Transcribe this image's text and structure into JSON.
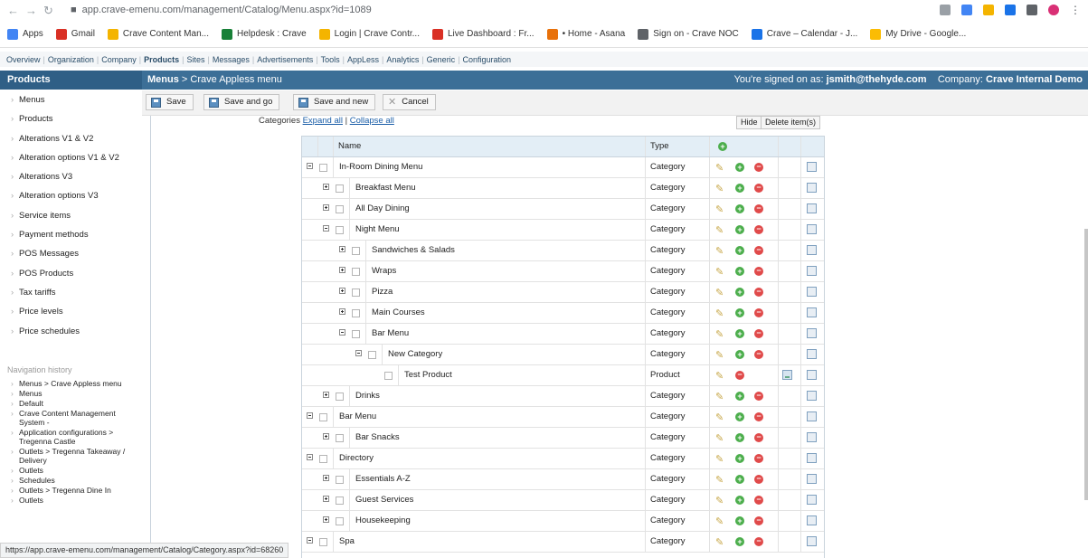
{
  "browser": {
    "url": "app.crave-emenu.com/management/Catalog/Menu.aspx?id=1089",
    "bookmarks": [
      {
        "label": "Apps",
        "color": "#4285f4"
      },
      {
        "label": "Gmail",
        "color": "#d93025"
      },
      {
        "label": "Crave Content Man...",
        "color": "#f4b400"
      },
      {
        "label": "Helpdesk : Crave",
        "color": "#188038"
      },
      {
        "label": "Login | Crave Contr...",
        "color": "#f4b400"
      },
      {
        "label": "Live Dashboard : Fr...",
        "color": "#d93025"
      },
      {
        "label": "• Home - Asana",
        "color": "#e8710a"
      },
      {
        "label": "Sign on - Crave NOC",
        "color": "#5f6368"
      },
      {
        "label": "Crave – Calendar - J...",
        "color": "#1a73e8"
      },
      {
        "label": "My Drive - Google...",
        "color": "#fbbc04"
      }
    ],
    "status_url": "https://app.crave-emenu.com/management/Catalog/Category.aspx?id=68260"
  },
  "app_menu": [
    {
      "label": "Overview",
      "active": false
    },
    {
      "label": "Organization",
      "active": false
    },
    {
      "label": "Company",
      "active": false
    },
    {
      "label": "Products",
      "active": true
    },
    {
      "label": "Sites",
      "active": false
    },
    {
      "label": "Messages",
      "active": false
    },
    {
      "label": "Advertisements",
      "active": false
    },
    {
      "label": "Tools",
      "active": false
    },
    {
      "label": "AppLess",
      "active": false
    },
    {
      "label": "Analytics",
      "active": false
    },
    {
      "label": "Generic",
      "active": false
    },
    {
      "label": "Configuration",
      "active": false
    }
  ],
  "sidebar": {
    "title": "Products",
    "items": [
      "Menus",
      "Products",
      "Alterations V1 & V2",
      "Alteration options V1 & V2",
      "Alterations V3",
      "Alteration options V3",
      "Service items",
      "Payment methods",
      "POS Messages",
      "POS Products",
      "Tax tariffs",
      "Price levels",
      "Price schedules"
    ],
    "history_title": "Navigation history",
    "history": [
      "Menus > Crave Appless menu",
      "Menus",
      "Default",
      "Crave Content Management System -",
      "Application configurations > Tregenna Castle",
      "Outlets > Tregenna Takeaway / Delivery",
      "Outlets",
      "Schedules",
      "Outlets > Tregenna Dine In",
      "Outlets"
    ]
  },
  "header": {
    "breadcrumb_section": "Menus",
    "breadcrumb_sep": ">",
    "breadcrumb_page": "Crave Appless menu",
    "signed_label": "You're signed on as:",
    "signed_user": "jsmith@thehyde.com",
    "company_label": "Company:",
    "company_name": "Crave Internal Demo"
  },
  "toolbar": {
    "save": "Save",
    "save_go": "Save and go",
    "save_new": "Save and new",
    "cancel": "Cancel"
  },
  "categories": {
    "label": "Categories",
    "expand_all": "Expand all",
    "separator": "|",
    "collapse_all": "Collapse all",
    "hide": "Hide",
    "delete_items": "Delete item(s)"
  },
  "grid": {
    "col_name": "Name",
    "col_type": "Type",
    "rows": [
      {
        "name": "In-Room Dining Menu",
        "type": "Category",
        "depth": 0,
        "expanded": true,
        "add": true
      },
      {
        "name": "Breakfast Menu",
        "type": "Category",
        "depth": 1,
        "expanded": false,
        "add": true
      },
      {
        "name": "All Day Dining",
        "type": "Category",
        "depth": 1,
        "expanded": false,
        "add": true
      },
      {
        "name": "Night Menu",
        "type": "Category",
        "depth": 1,
        "expanded": true,
        "add": true
      },
      {
        "name": "Sandwiches & Salads",
        "type": "Category",
        "depth": 2,
        "expanded": false,
        "add": true
      },
      {
        "name": "Wraps",
        "type": "Category",
        "depth": 2,
        "expanded": false,
        "add": true
      },
      {
        "name": "Pizza",
        "type": "Category",
        "depth": 2,
        "expanded": false,
        "add": true
      },
      {
        "name": "Main Courses",
        "type": "Category",
        "depth": 2,
        "expanded": false,
        "add": true
      },
      {
        "name": "Bar Menu",
        "type": "Category",
        "depth": 2,
        "expanded": true,
        "add": true
      },
      {
        "name": "New Category",
        "type": "Category",
        "depth": 3,
        "expanded": true,
        "add": true
      },
      {
        "name": "Test Product",
        "type": "Product",
        "depth": 4,
        "leaf": true,
        "add": false
      },
      {
        "name": "Drinks",
        "type": "Category",
        "depth": 1,
        "expanded": false,
        "add": true
      },
      {
        "name": "Bar Menu",
        "type": "Category",
        "depth": 0,
        "expanded": true,
        "add": true
      },
      {
        "name": "Bar Snacks",
        "type": "Category",
        "depth": 1,
        "expanded": false,
        "add": true
      },
      {
        "name": "Directory",
        "type": "Category",
        "depth": 0,
        "expanded": true,
        "add": true
      },
      {
        "name": "Essentials A-Z",
        "type": "Category",
        "depth": 1,
        "expanded": false,
        "add": true
      },
      {
        "name": "Guest Services",
        "type": "Category",
        "depth": 1,
        "expanded": false,
        "add": true
      },
      {
        "name": "Housekeeping",
        "type": "Category",
        "depth": 1,
        "expanded": false,
        "add": true
      },
      {
        "name": "Spa",
        "type": "Category",
        "depth": 0,
        "expanded": true,
        "add": true
      }
    ]
  }
}
